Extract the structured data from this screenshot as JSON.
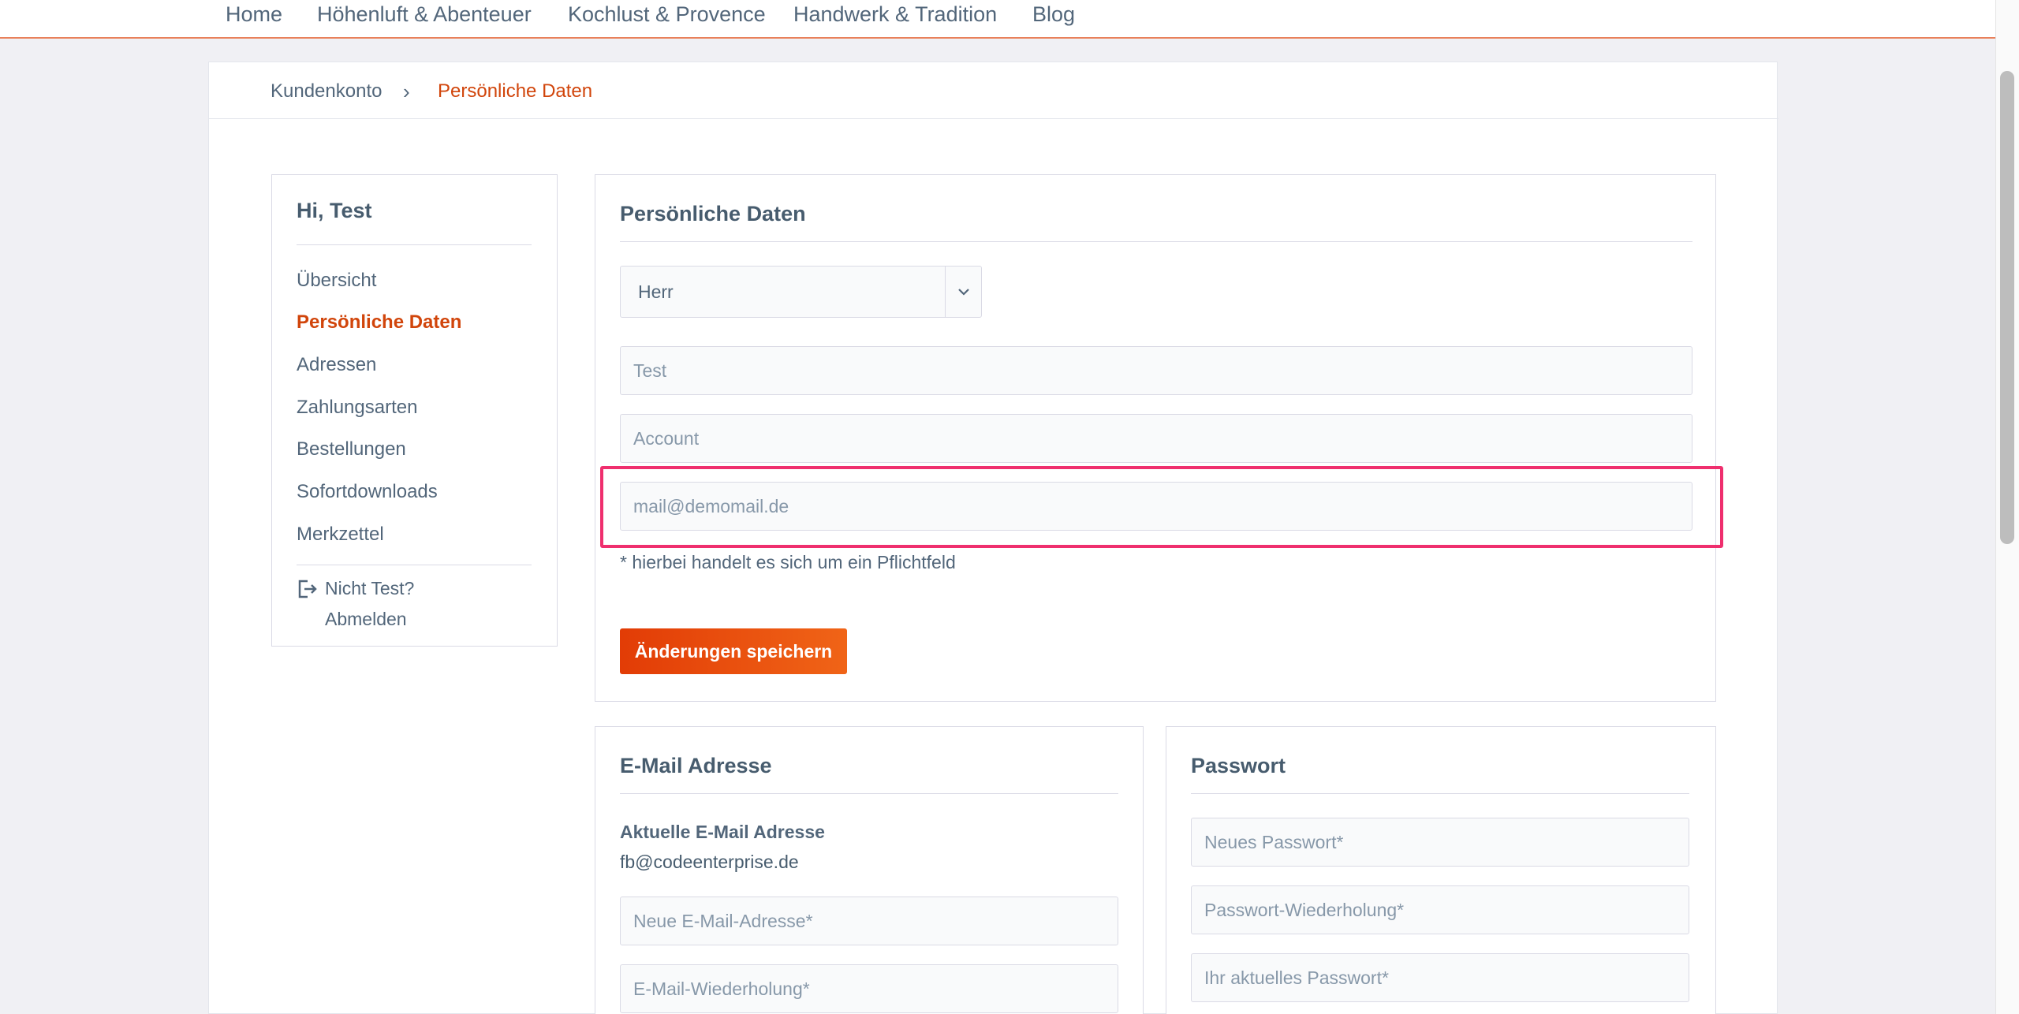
{
  "nav": {
    "items": [
      "Home",
      "Höhenluft & Abenteuer",
      "Kochlust & Provence",
      "Handwerk & Tradition",
      "Blog"
    ]
  },
  "breadcrumb": {
    "items": [
      "Kundenkonto",
      "Persönliche Daten"
    ],
    "separator": "›"
  },
  "sidebar": {
    "greeting": "Hi, Test",
    "items": [
      "Übersicht",
      "Persönliche Daten",
      "Adressen",
      "Zahlungsarten",
      "Bestellungen",
      "Sofortdownloads",
      "Merkzettel"
    ],
    "active_index": 1,
    "logout_line1": "Nicht Test?",
    "logout_line2": "Abmelden",
    "logout_icon": "logout-icon"
  },
  "personal": {
    "title": "Persönliche Daten",
    "salutation": "Herr",
    "first_name": "Test",
    "last_name": "Account",
    "email": "mail@demomail.de",
    "required_note": "* hierbei handelt es sich um ein Pflichtfeld",
    "save_label": "Änderungen speichern"
  },
  "email_panel": {
    "title": "E-Mail Adresse",
    "current_label": "Aktuelle E-Mail Adresse",
    "current_value": "fb@codeenterprise.de",
    "new_placeholder": "Neue E-Mail-Adresse*",
    "repeat_placeholder": "E-Mail-Wiederholung*"
  },
  "password_panel": {
    "title": "Passwort",
    "new_placeholder": "Neues Passwort*",
    "repeat_placeholder": "Passwort-Wiederholung*",
    "current_placeholder": "Ihr aktuelles Passwort*"
  },
  "colors": {
    "accent": "#d1450b",
    "button": "#e34d08",
    "highlight": "#ef2f6e",
    "text": "#52667a"
  }
}
